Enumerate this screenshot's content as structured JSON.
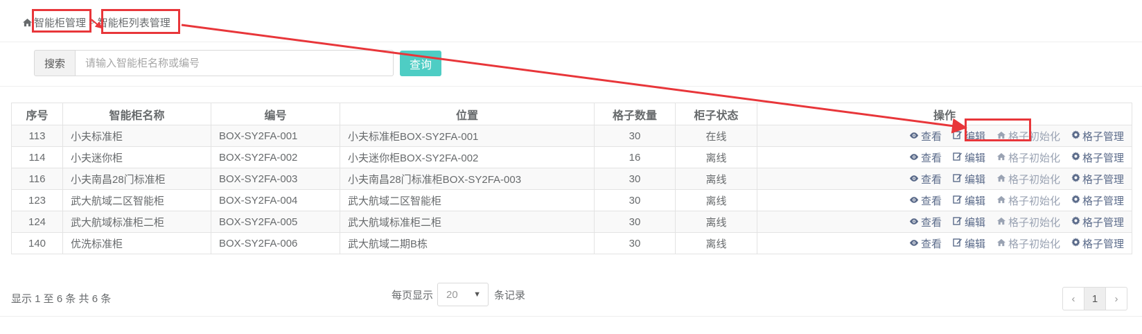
{
  "breadcrumb": {
    "items": [
      "智能柜管理",
      "智能柜列表管理"
    ],
    "separator": ">"
  },
  "search": {
    "addon_label": "搜索",
    "placeholder": "请输入智能柜名称或编号",
    "value": "",
    "button_label": "查询"
  },
  "table": {
    "headers": [
      "序号",
      "智能柜名称",
      "编号",
      "位置",
      "格子数量",
      "柜子状态",
      "操作"
    ],
    "rows": [
      {
        "id": "113",
        "name": "小夫标准柜",
        "code": "BOX-SY2FA-001",
        "location": "小夫标准柜BOX-SY2FA-001",
        "slots": "30",
        "status": "在线"
      },
      {
        "id": "114",
        "name": "小夫迷你柜",
        "code": "BOX-SY2FA-002",
        "location": "小夫迷你柜BOX-SY2FA-002",
        "slots": "16",
        "status": "离线"
      },
      {
        "id": "116",
        "name": "小夫南昌28门标准柜",
        "code": "BOX-SY2FA-003",
        "location": "小夫南昌28门标准柜BOX-SY2FA-003",
        "slots": "30",
        "status": "离线"
      },
      {
        "id": "123",
        "name": "武大航域二区智能柜",
        "code": "BOX-SY2FA-004",
        "location": "武大航域二区智能柜",
        "slots": "30",
        "status": "离线"
      },
      {
        "id": "124",
        "name": "武大航域标准柜二柜",
        "code": "BOX-SY2FA-005",
        "location": "武大航域标准柜二柜",
        "slots": "30",
        "status": "离线"
      },
      {
        "id": "140",
        "name": "优洗标准柜",
        "code": "BOX-SY2FA-006",
        "location": "武大航域二期B栋",
        "slots": "30",
        "status": "离线"
      }
    ],
    "actions": {
      "view": "查看",
      "edit": "编辑",
      "init": "格子初始化",
      "manage": "格子管理"
    }
  },
  "footer": {
    "info": "显示 1 至 6 条   共 6 条",
    "per_page_prefix": "每页显示",
    "per_page_value": "20",
    "per_page_suffix": "条记录",
    "pages": [
      "‹",
      "1",
      "›"
    ]
  },
  "colors": {
    "primary_button": "#4ecdc4",
    "online": "#1a8f1a",
    "offline": "#e02020",
    "annotation": "#e8363a"
  },
  "icons": {
    "home": "home-icon",
    "view": "eye-icon",
    "edit": "edit-icon",
    "init": "home-icon",
    "manage": "gear-icon",
    "caret": "caret-down-icon"
  }
}
